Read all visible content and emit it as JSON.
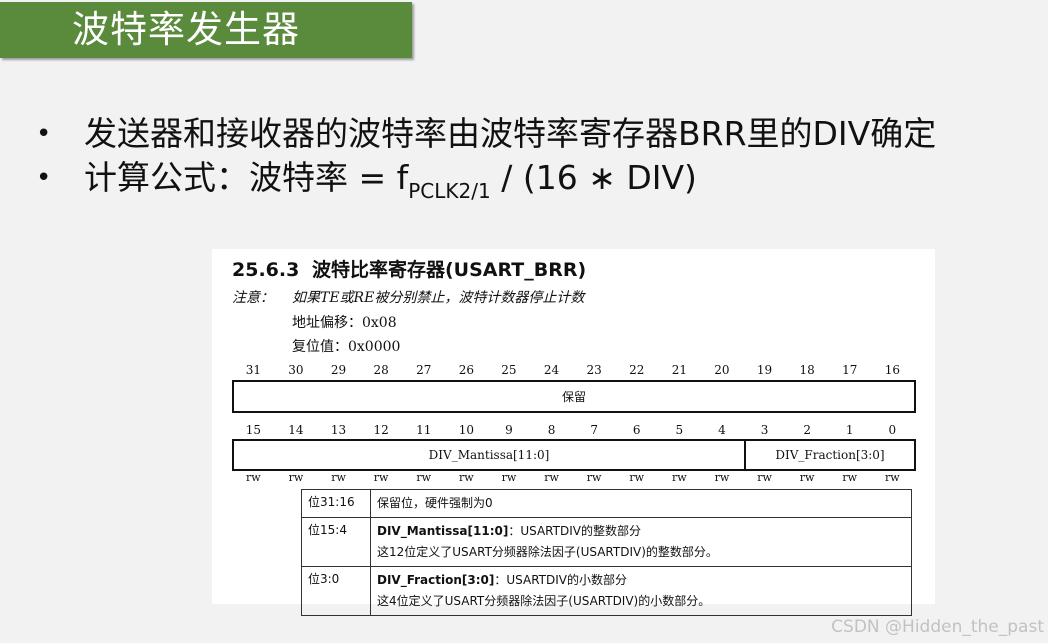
{
  "slide": {
    "title": "波特率发生器",
    "bullets": [
      {
        "text": "发送器和接收器的波特率由波特率寄存器BRR里的DIV确定"
      },
      {
        "pre": "计算公式：波特率 = f",
        "sub": "PCLK2/1",
        "post": " / (16 ∗ DIV)"
      }
    ],
    "bullet_symbol": "•"
  },
  "doc": {
    "section_num": "25.6.3",
    "section_title": "波特比率寄存器(USART_BRR)",
    "note_label": "注意：",
    "note_text": "如果TE或RE被分别禁止，波特计数器停止计数",
    "address": "地址偏移：0x08",
    "reset": "复位值：0x0000",
    "bits_high": [
      "31",
      "30",
      "29",
      "28",
      "27",
      "26",
      "25",
      "24",
      "23",
      "22",
      "21",
      "20",
      "19",
      "18",
      "17",
      "16"
    ],
    "bits_low": [
      "15",
      "14",
      "13",
      "12",
      "11",
      "10",
      "9",
      "8",
      "7",
      "6",
      "5",
      "4",
      "3",
      "2",
      "1",
      "0"
    ],
    "reserved_label": "保留",
    "mantissa_label": "DIV_Mantissa[11:0]",
    "fraction_label": "DIV_Fraction[3:0]",
    "access": [
      "rw",
      "rw",
      "rw",
      "rw",
      "rw",
      "rw",
      "rw",
      "rw",
      "rw",
      "rw",
      "rw",
      "rw",
      "rw",
      "rw",
      "rw",
      "rw"
    ],
    "table": [
      {
        "bits": "位31:16",
        "lines": [
          "保留位，硬件强制为0"
        ]
      },
      {
        "bits": "位15:4",
        "name": "DIV_Mantissa[11:0]",
        "name_suffix": "：USARTDIV的整数部分",
        "lines": [
          "这12位定义了USART分频器除法因子(USARTDIV)的整数部分。"
        ]
      },
      {
        "bits": "位3:0",
        "name": "DIV_Fraction[3:0]",
        "name_suffix": "：USARTDIV的小数部分",
        "lines": [
          "这4位定义了USART分频器除法因子(USARTDIV)的小数部分。"
        ]
      }
    ]
  },
  "watermark": "CSDN @Hidden_the_past"
}
